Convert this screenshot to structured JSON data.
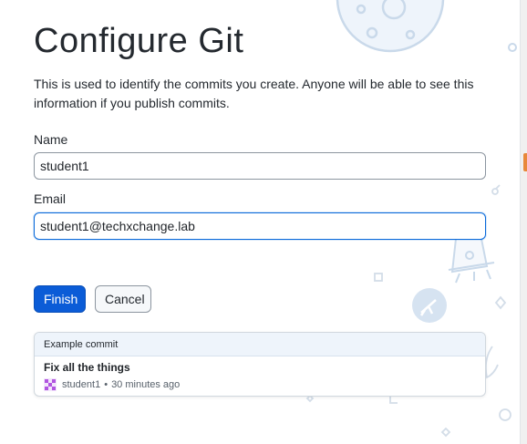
{
  "page": {
    "title": "Configure Git",
    "intro": "This is used to identify the commits you create. Anyone will be able to see this information if you publish commits."
  },
  "form": {
    "name_label": "Name",
    "name_value": "student1",
    "email_label": "Email",
    "email_value": "student1@techxchange.lab"
  },
  "actions": {
    "finish_label": "Finish",
    "cancel_label": "Cancel"
  },
  "example_commit": {
    "header": "Example commit",
    "summary": "Fix all the things",
    "author": "student1",
    "separator": "•",
    "time": "30 minutes ago"
  },
  "colors": {
    "primary": "#0b5cd7",
    "focus": "#0969da",
    "art_stroke": "#c9d9ea"
  },
  "icons": [
    "moon-illustration",
    "rocket-illustration",
    "telescope-icon",
    "sparkle-icon",
    "avatar-identicon"
  ]
}
